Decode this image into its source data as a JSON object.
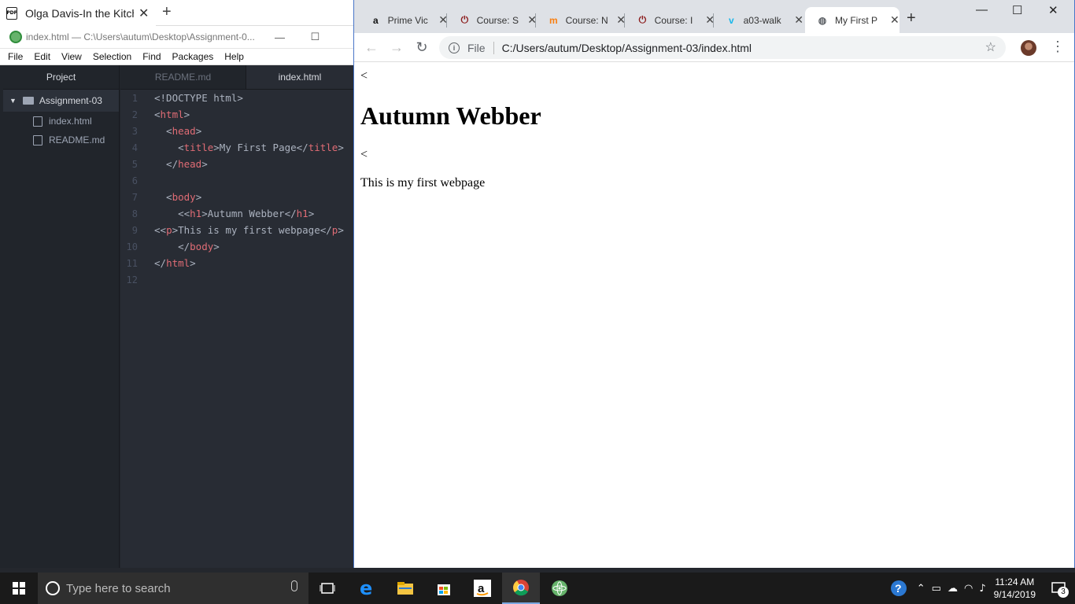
{
  "back_window": {
    "tab_title": "Olga Davis-In the Kitche",
    "pdf_label": "PDF",
    "close": "✕",
    "new_tab": "+"
  },
  "atom": {
    "window_title": "index.html — C:\\Users\\autum\\Desktop\\Assignment-0...",
    "minimize": "—",
    "maximize": "☐",
    "menu": [
      "File",
      "Edit",
      "View",
      "Selection",
      "Find",
      "Packages",
      "Help"
    ],
    "tree": {
      "header": "Project",
      "root": "Assignment-03",
      "files": [
        "index.html",
        "README.md"
      ]
    },
    "tabs": [
      "README.md",
      "index.html"
    ],
    "code_lines": [
      {
        "n": "1",
        "html": "<!DOCTYPE html>"
      },
      {
        "n": "2",
        "html": "<html>"
      },
      {
        "n": "3",
        "html": "  <head>"
      },
      {
        "n": "4",
        "html": "    <title>My First Page</title>"
      },
      {
        "n": "5",
        "html": "  </head>"
      },
      {
        "n": "6",
        "html": ""
      },
      {
        "n": "7",
        "html": "  <body>"
      },
      {
        "n": "8",
        "html": "    <<h1>Autumn Webber</h1>"
      },
      {
        "n": "9",
        "html": "<<p>This is my first webpage</p>"
      },
      {
        "n": "10",
        "html": "    </body>"
      },
      {
        "n": "11",
        "html": "</html>"
      },
      {
        "n": "12",
        "html": ""
      }
    ]
  },
  "chrome": {
    "tabs": [
      {
        "title": "Prime Vic",
        "icon": "amazon-icon",
        "glyph": "a",
        "color": "#111"
      },
      {
        "title": "Course: S",
        "icon": "power-icon",
        "glyph": "⏻",
        "color": "#8b1a1a"
      },
      {
        "title": "Course: N",
        "icon": "moodle-icon",
        "glyph": "m",
        "color": "#f98012"
      },
      {
        "title": "Course: I",
        "icon": "power-icon",
        "glyph": "⏻",
        "color": "#8b1a1a"
      },
      {
        "title": "a03-walk",
        "icon": "vimeo-icon",
        "glyph": "v",
        "color": "#1ab7ea"
      },
      {
        "title": "My First P",
        "icon": "globe-icon",
        "glyph": "◍",
        "color": "#5f6368"
      }
    ],
    "new_tab": "+",
    "win_minimize": "—",
    "win_maximize": "☐",
    "win_close": "✕",
    "back": "←",
    "forward": "→",
    "reload": "↻",
    "url_scheme_label": "File",
    "url": "C:/Users/autum/Desktop/Assignment-03/index.html",
    "star": "☆",
    "menu": "⋮"
  },
  "page": {
    "stray1": "<",
    "heading": "Autumn Webber",
    "stray2": "<",
    "paragraph": "This is my first webpage"
  },
  "taskbar": {
    "search_placeholder": "Type here to search",
    "time": "11:24 AM",
    "date": "9/14/2019",
    "notification_count": "3"
  }
}
